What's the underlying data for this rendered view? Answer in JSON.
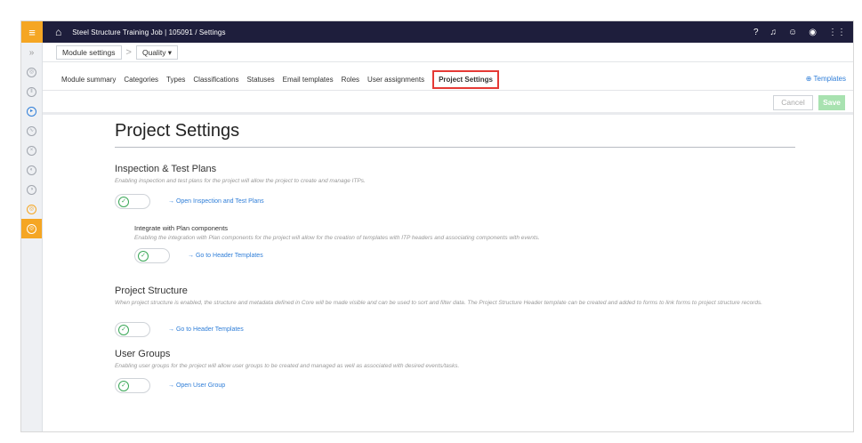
{
  "topbar": {
    "menu_icon": "hamburger-icon",
    "breadcrumb": "Steel Structure Training Job | 105091  /  Settings",
    "tools": [
      "help-icon",
      "bell-icon",
      "user-icon",
      "signout-icon",
      "apps-icon"
    ]
  },
  "module_row": {
    "module_settings": "Module settings",
    "separator": ">",
    "module": "Quality ▾"
  },
  "tabs": [
    {
      "label": "Module summary"
    },
    {
      "label": "Categories"
    },
    {
      "label": "Types"
    },
    {
      "label": "Classifications"
    },
    {
      "label": "Statuses"
    },
    {
      "label": "Email templates"
    },
    {
      "label": "Roles"
    },
    {
      "label": "User assignments"
    },
    {
      "label": "Project Settings"
    }
  ],
  "templates_link": "Templates",
  "actions": {
    "cancel": "Cancel",
    "save": "Save"
  },
  "page_title": "Project Settings",
  "sections": {
    "itp": {
      "title": "Inspection & Test Plans",
      "desc": "Enabling inspection and test plans for the project will allow the project to create and manage ITPs.",
      "link": "→ Open Inspection and Test Plans"
    },
    "plan": {
      "title": "Integrate with Plan components",
      "desc": "Enabling the integration with Plan components for the project will allow for the creation of templates with ITP headers and associating components with events.",
      "link": "→ Go to Header Templates"
    },
    "structure": {
      "title": "Project Structure",
      "desc": "When project structure is enabled, the structure and metadata defined in Core will be made visible and can be used to sort and filter data. The Project Structure Header template can be created and added to forms to link forms to project structure records.",
      "link": "→ Go to Header Templates"
    },
    "groups": {
      "title": "User Groups",
      "desc": "Enabling user groups for the project will allow user groups to be created and managed as well as associated with desired events/tasks.",
      "link": "→ Open User Group"
    }
  },
  "toggle_check": "✓",
  "colors": {
    "topbar": "#1e1e3c",
    "accent": "#f5a623",
    "link": "#2f7ed8",
    "save": "#a8e2b0",
    "toggle_on": "#3aa757",
    "highlight": "#e53935"
  }
}
